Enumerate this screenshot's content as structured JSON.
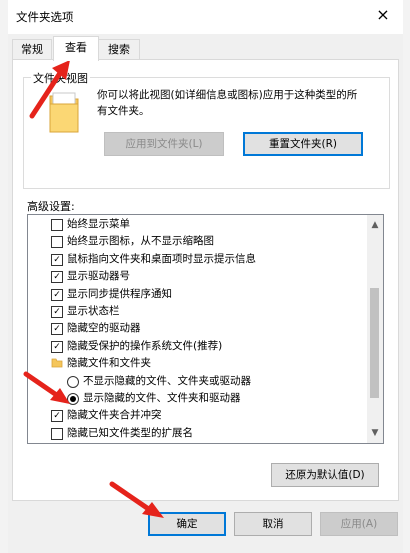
{
  "dialog": {
    "title": "文件夹选项",
    "close_icon": "×"
  },
  "tabs": [
    {
      "label": "常规",
      "active": false
    },
    {
      "label": "查看",
      "active": true
    },
    {
      "label": "搜索",
      "active": false
    }
  ],
  "folder_view": {
    "group_label": "文件夹视图",
    "description": "你可以将此视图(如详细信息或图标)应用于这种类型的所有文件夹。",
    "apply_button": "应用到文件夹(L)",
    "reset_button": "重置文件夹(R)"
  },
  "advanced": {
    "label": "高级设置:",
    "items": [
      {
        "type": "checkbox",
        "checked": false,
        "indent": 1,
        "label": "始终显示菜单"
      },
      {
        "type": "checkbox",
        "checked": false,
        "indent": 1,
        "label": "始终显示图标，从不显示缩略图"
      },
      {
        "type": "checkbox",
        "checked": true,
        "indent": 1,
        "label": "鼠标指向文件夹和桌面项时显示提示信息"
      },
      {
        "type": "checkbox",
        "checked": true,
        "indent": 1,
        "label": "显示驱动器号"
      },
      {
        "type": "checkbox",
        "checked": true,
        "indent": 1,
        "label": "显示同步提供程序通知"
      },
      {
        "type": "checkbox",
        "checked": true,
        "indent": 1,
        "label": "显示状态栏"
      },
      {
        "type": "checkbox",
        "checked": true,
        "indent": 1,
        "label": "隐藏空的驱动器"
      },
      {
        "type": "checkbox",
        "checked": true,
        "indent": 1,
        "label": "隐藏受保护的操作系统文件(推荐)"
      },
      {
        "type": "folder",
        "indent": 1,
        "label": "隐藏文件和文件夹"
      },
      {
        "type": "radio",
        "checked": false,
        "indent": 2,
        "label": "不显示隐藏的文件、文件夹或驱动器"
      },
      {
        "type": "radio",
        "checked": true,
        "indent": 2,
        "label": "显示隐藏的文件、文件夹和驱动器"
      },
      {
        "type": "checkbox",
        "checked": true,
        "indent": 1,
        "label": "隐藏文件夹合并冲突"
      },
      {
        "type": "checkbox",
        "checked": false,
        "indent": 1,
        "label": "隐藏已知文件类型的扩展名"
      }
    ],
    "restore_button": "还原为默认值(D)"
  },
  "footer": {
    "ok": "确定",
    "cancel": "取消",
    "apply": "应用(A)"
  },
  "colors": {
    "annotation_arrow": "#e5231b",
    "focus_border": "#0078d7"
  }
}
